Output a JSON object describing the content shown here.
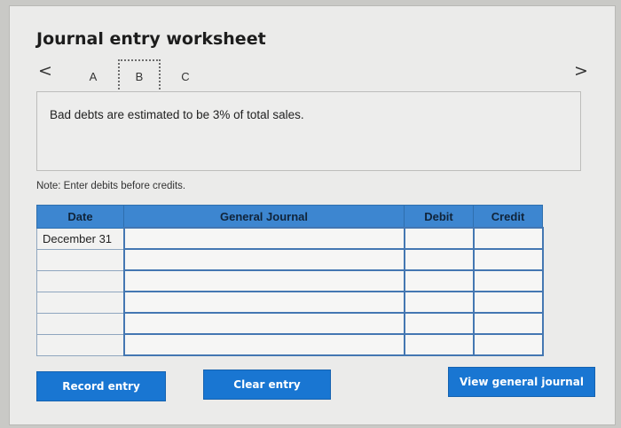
{
  "page": {
    "title": "Journal entry worksheet"
  },
  "nav": {
    "prev": "<",
    "next": ">"
  },
  "tabs": [
    "A",
    "B",
    "C"
  ],
  "info": {
    "text": "Bad debts are estimated to be 3% of total sales."
  },
  "note": "Note: Enter debits before credits.",
  "table": {
    "headers": [
      "Date",
      "General Journal",
      "Debit",
      "Credit"
    ],
    "rows": [
      {
        "date": "December 31"
      },
      {
        "date": ""
      },
      {
        "date": ""
      },
      {
        "date": ""
      },
      {
        "date": ""
      },
      {
        "date": ""
      }
    ]
  },
  "buttons": {
    "record": "Record entry",
    "clear": "Clear entry",
    "view": "View general journal"
  },
  "colors": {
    "header_blue": "#3d86d0",
    "button_blue": "#1976d2"
  }
}
